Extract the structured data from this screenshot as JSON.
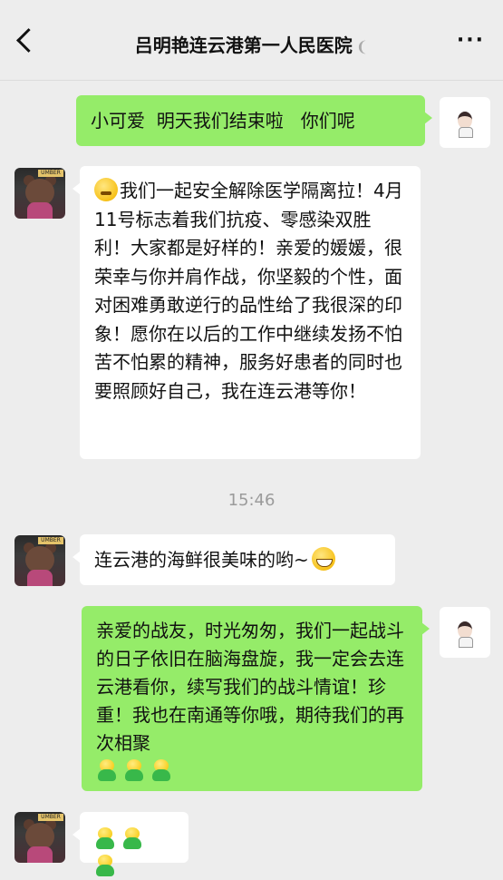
{
  "header": {
    "title": "吕明艳连云港第一人民医院",
    "back_icon": "chevron-left-icon",
    "mute_icon": "ear-icon",
    "more_label": "···"
  },
  "messages": [
    {
      "side": "right",
      "text": "小可爱  明天我们结束啦   你们呢"
    },
    {
      "side": "left",
      "emoji_leading": "sweat-smile-emoji",
      "text": "我们一起安全解除医学隔离拉！4月11号标志着我们抗疫、零感染双胜利！大家都是好样的！亲爱的媛媛，很荣幸与你并肩作战，你坚毅的个性，面对困难勇敢逆行的品性给了我很深的印象！愿你在以后的工作中继续发扬不怕苦不怕累的精神，服务好患者的同时也要照顾好自己，我在连云港等你！"
    },
    {
      "side": "left",
      "text": "连云港的海鲜很美味的哟~",
      "emoji_trailing": "grin-emoji"
    },
    {
      "side": "right",
      "text": "亲爱的战友，时光匆匆，我们一起战斗的日子依旧在脑海盘旋，我一定会去连云港看你，续写我们的战斗情谊！珍重！我也在南通等你哦，期待我们的再次相聚",
      "emoji_trailing": "chick-emoji x3"
    },
    {
      "side": "left",
      "emoji_only": "chick-emoji x3"
    }
  ],
  "timestamp": "15:46",
  "avatar_sign_text": "UMBER",
  "colors": {
    "background": "#ededed",
    "bubble_self": "#95ec69",
    "bubble_other": "#ffffff",
    "timestamp": "#9b9b9b"
  }
}
